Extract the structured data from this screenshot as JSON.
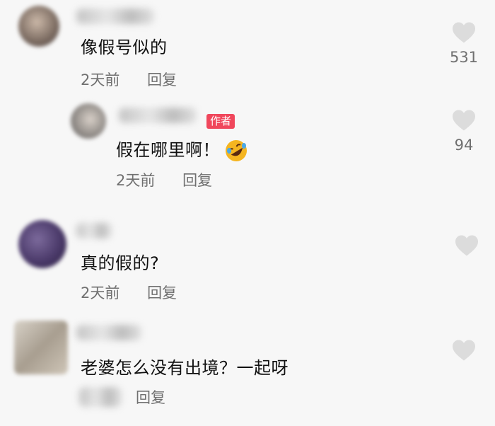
{
  "comments": [
    {
      "text": "像假号似的",
      "date": "2天前",
      "reply": "回复",
      "likes": "531"
    },
    {
      "badge": "作者",
      "text": "假在哪里啊！",
      "emoji": "rolling-on-floor-laughing-emoji",
      "date": "2天前",
      "reply": "回复",
      "likes": "94"
    },
    {
      "text": "真的假的?",
      "date": "2天前",
      "reply": "回复"
    },
    {
      "text": "老婆怎么没有出境？一起呀",
      "reply": "回复"
    }
  ],
  "icons": {
    "like": "heart-icon"
  },
  "colors": {
    "background": "#f7f7f7",
    "secondary_text": "#707070",
    "heart": "#dcdcdc",
    "author_badge": "#f0475c"
  }
}
